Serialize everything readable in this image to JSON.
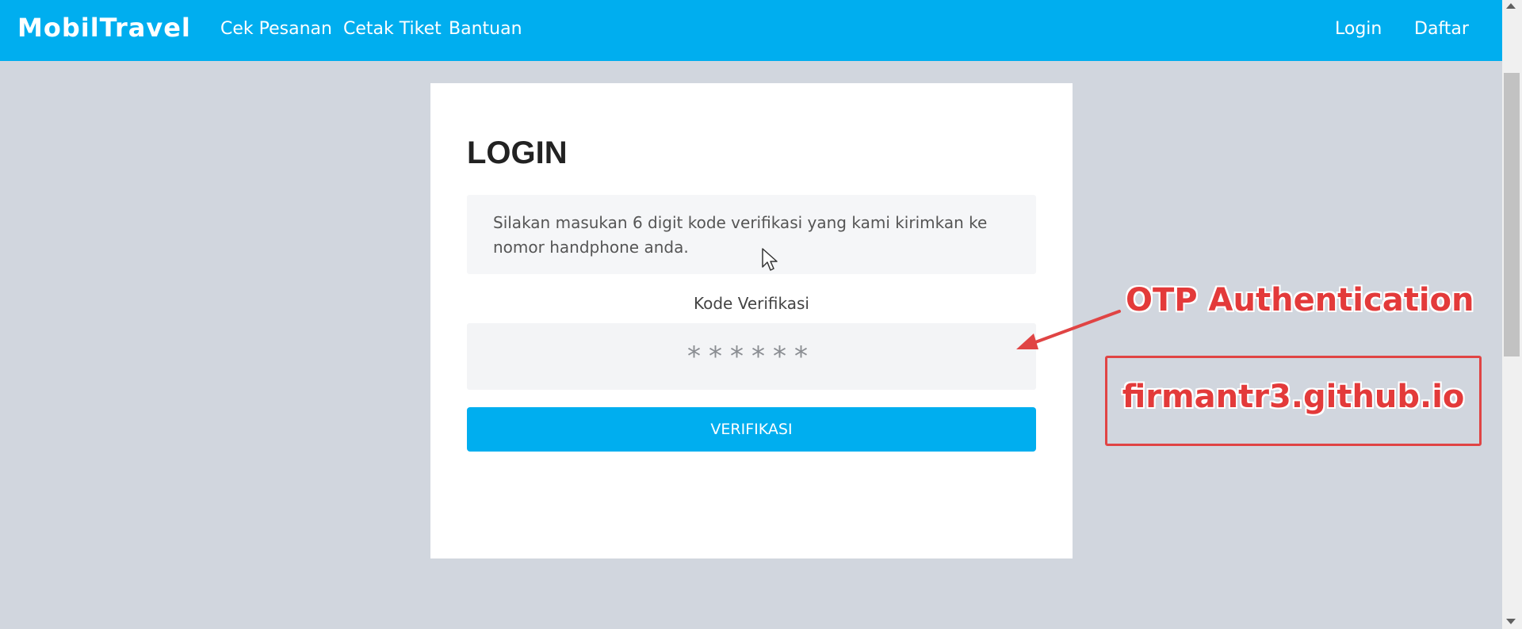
{
  "navbar": {
    "brand": "MobilTravel",
    "links": [
      "Cek Pesanan",
      "Cetak Tiket",
      "Bantuan"
    ],
    "login_label": "Login",
    "register_label": "Daftar"
  },
  "card": {
    "title": "LOGIN",
    "info_text": "Silakan masukan 6 digit kode verifikasi yang kami kirimkan ke nomor handphone anda.",
    "code_label": "Kode Verifikasi",
    "code_placeholder": "******",
    "verify_label": "VERIFIKASI"
  },
  "annotation": {
    "title": "OTP Authentication",
    "url": "firmantr3.github.io",
    "color": "#e33a3a"
  },
  "colors": {
    "primary": "#00aeef",
    "background": "#d1d6de"
  }
}
